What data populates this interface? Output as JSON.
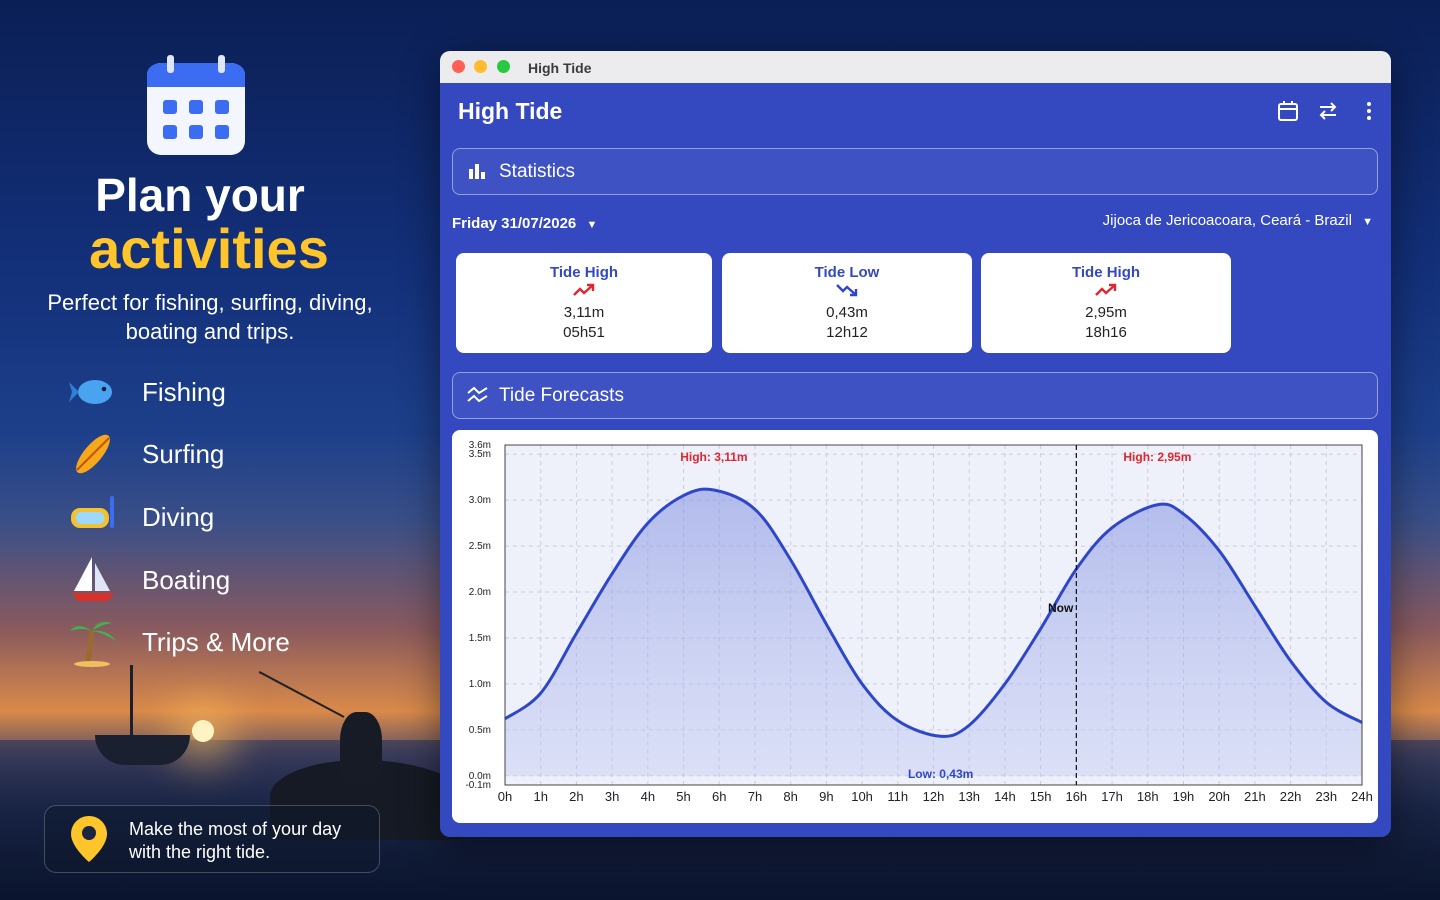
{
  "promo": {
    "headline_1": "Plan your",
    "headline_2": "activities",
    "subtitle": "Perfect for fishing, surfing, diving, boating and trips.",
    "activities": [
      {
        "label": "Fishing",
        "icon": "fish-icon"
      },
      {
        "label": "Surfing",
        "icon": "surfboard-icon"
      },
      {
        "label": "Diving",
        "icon": "diving-mask-icon"
      },
      {
        "label": "Boating",
        "icon": "sailboat-icon"
      },
      {
        "label": "Trips & More",
        "icon": "palm-tree-icon"
      }
    ],
    "cta_line1": "Make the most of your day",
    "cta_line2": "with the right tide."
  },
  "window": {
    "title": "High Tide",
    "app_title": "High Tide",
    "icons": [
      "calendar-icon",
      "swap-icon",
      "more-vert-icon"
    ],
    "statistics_label": "Statistics",
    "date": "Friday 31/07/2026",
    "location": "Jijoca de Jericoacoara, Ceará - Brazil",
    "cards": [
      {
        "title": "Tide High",
        "trend": "up",
        "height": "3,11m",
        "time": "05h51"
      },
      {
        "title": "Tide Low",
        "trend": "down",
        "height": "0,43m",
        "time": "12h12"
      },
      {
        "title": "Tide High",
        "trend": "up",
        "height": "2,95m",
        "time": "18h16"
      }
    ],
    "forecasts_label": "Tide Forecasts"
  },
  "colors": {
    "window_bg": "#3449c0",
    "accent_yellow": "#ffc52a",
    "trend_red": "#e0262f",
    "curve": "#2e47c9"
  },
  "chart_data": {
    "type": "area",
    "x": [
      0,
      1,
      2,
      3,
      4,
      5,
      5.85,
      7,
      8,
      9,
      10,
      11,
      12.2,
      13,
      14,
      15,
      16,
      17,
      18.27,
      19,
      20,
      21,
      22,
      23,
      24
    ],
    "y": [
      0.62,
      0.9,
      1.55,
      2.2,
      2.75,
      3.05,
      3.11,
      2.9,
      2.35,
      1.65,
      1.0,
      0.6,
      0.43,
      0.55,
      1.0,
      1.6,
      2.25,
      2.7,
      2.95,
      2.85,
      2.45,
      1.85,
      1.25,
      0.8,
      0.58
    ],
    "xticks": [
      "0h",
      "1h",
      "2h",
      "3h",
      "4h",
      "5h",
      "6h",
      "7h",
      "8h",
      "9h",
      "10h",
      "11h",
      "12h",
      "13h",
      "14h",
      "15h",
      "16h",
      "17h",
      "18h",
      "19h",
      "20h",
      "21h",
      "22h",
      "23h",
      "24h"
    ],
    "yticks": [
      {
        "v": -0.1,
        "label": "-0.1m"
      },
      {
        "v": 0.0,
        "label": "0.0m"
      },
      {
        "v": 0.5,
        "label": "0.5m"
      },
      {
        "v": 1.0,
        "label": "1.0m"
      },
      {
        "v": 1.5,
        "label": "1.5m"
      },
      {
        "v": 2.0,
        "label": "2.0m"
      },
      {
        "v": 2.5,
        "label": "2.5m"
      },
      {
        "v": 3.0,
        "label": "3.0m"
      },
      {
        "v": 3.5,
        "label": "3.5m"
      },
      {
        "v": 3.6,
        "label": "3.6m"
      }
    ],
    "xlim": [
      0,
      24
    ],
    "ylim": [
      -0.1,
      3.6
    ],
    "grid": true,
    "annotations": [
      {
        "x": 5.85,
        "y": 3.11,
        "text": "High: 3,11m",
        "position": "above-top",
        "color": "#e0262f"
      },
      {
        "x": 12.2,
        "y": 0.43,
        "text": "Low: 0,43m",
        "position": "bottom",
        "color": "#2e47c9"
      },
      {
        "x": 18.27,
        "y": 2.95,
        "text": "High: 2,95m",
        "position": "above-top",
        "color": "#e0262f"
      }
    ],
    "now": {
      "x": 16.0,
      "label": "Now"
    }
  }
}
